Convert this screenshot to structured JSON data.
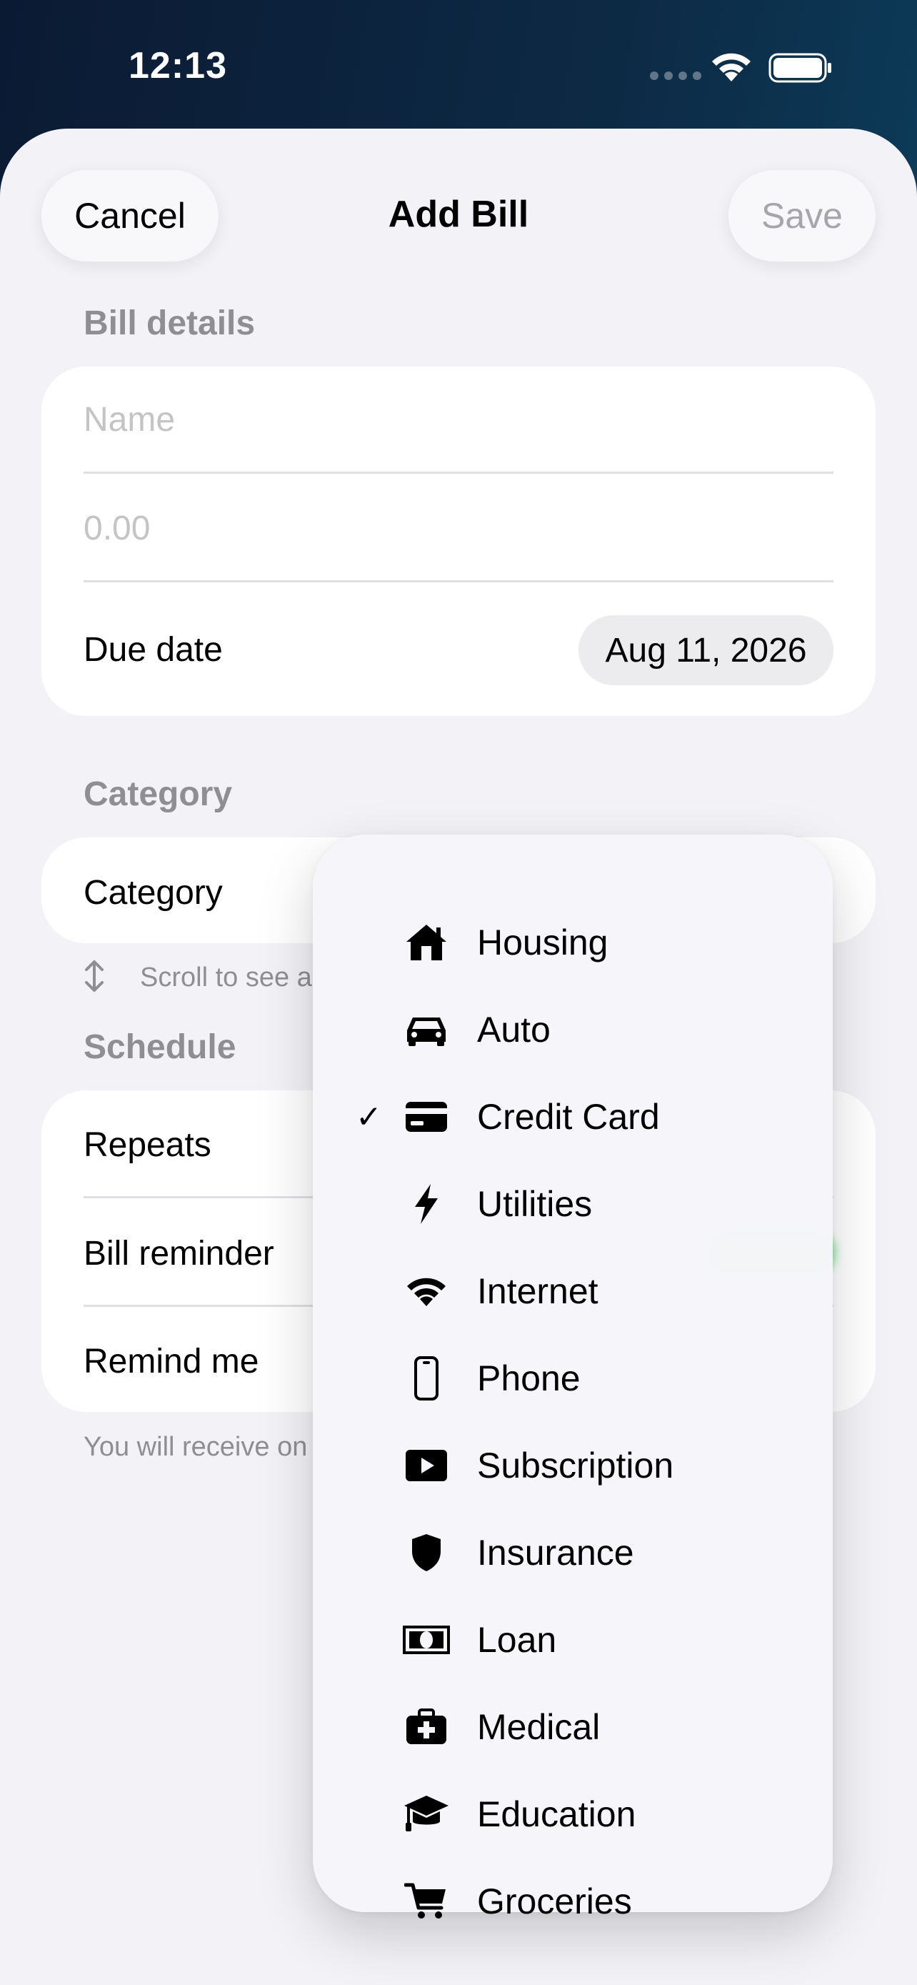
{
  "status_bar": {
    "time": "12:13"
  },
  "nav": {
    "cancel": "Cancel",
    "title": "Add Bill",
    "save": "Save"
  },
  "bill_details": {
    "header": "Bill details",
    "name_placeholder": "Name",
    "amount_placeholder": "0.00",
    "due_date_label": "Due date",
    "due_date_value": "Aug 11, 2026"
  },
  "category_section": {
    "header": "Category",
    "row_label": "Category",
    "scroll_hint": "Scroll to see a"
  },
  "schedule": {
    "header": "Schedule",
    "repeats": "Repeats",
    "bill_reminder": "Bill reminder",
    "remind_me": "Remind me",
    "footnote": "You will receive on"
  },
  "category_menu": {
    "selected": "Credit Card",
    "items": [
      {
        "label": "Housing",
        "icon": "house-icon"
      },
      {
        "label": "Auto",
        "icon": "car-icon"
      },
      {
        "label": "Credit Card",
        "icon": "creditcard-icon"
      },
      {
        "label": "Utilities",
        "icon": "bolt-icon"
      },
      {
        "label": "Internet",
        "icon": "wifi-icon"
      },
      {
        "label": "Phone",
        "icon": "phone-icon"
      },
      {
        "label": "Subscription",
        "icon": "play-rectangle-icon"
      },
      {
        "label": "Insurance",
        "icon": "shield-icon"
      },
      {
        "label": "Loan",
        "icon": "banknote-icon"
      },
      {
        "label": "Medical",
        "icon": "medical-bag-icon"
      },
      {
        "label": "Education",
        "icon": "graduation-cap-icon"
      },
      {
        "label": "Groceries",
        "icon": "cart-icon"
      }
    ]
  },
  "colors": {
    "toggle_on": "#34c759",
    "sheet_bg": "#f2f2f7",
    "placeholder": "#c4c4c7",
    "secondary": "#8e8e93"
  }
}
